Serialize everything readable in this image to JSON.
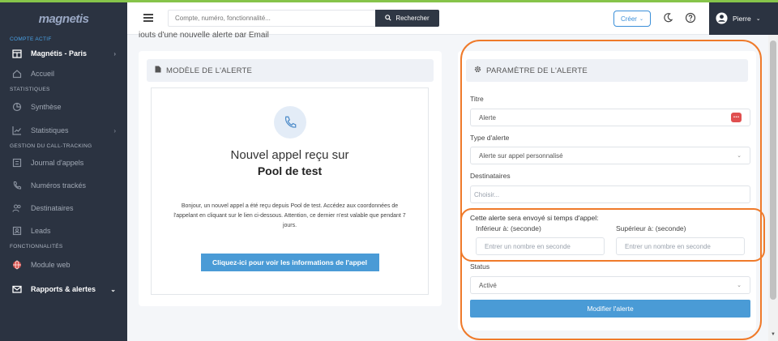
{
  "sidebar": {
    "logo": "magnetis",
    "sections": {
      "active_account": "COMPTE ACTIF",
      "stats": "STATISTIQUES",
      "calltracking": "GESTION DU CALL-TRACKING",
      "features": "FONCTIONNALITÉS"
    },
    "account": "Magnétis - Paris",
    "items": {
      "home": "Accueil",
      "summary": "Synthèse",
      "statistics": "Statistiques",
      "call_log": "Journal d'appels",
      "tracked_numbers": "Numéros trackés",
      "recipients": "Destinataires",
      "leads": "Leads",
      "web_module": "Module web",
      "reports": "Rapports & alertes"
    }
  },
  "topbar": {
    "search_placeholder": "Compte, numéro, fonctionnalité...",
    "search_button": "Rechercher",
    "create_button": "Créer",
    "user_name": "Pierre"
  },
  "page": {
    "cut_text": "jouts d'une nouvelle alerte par Email"
  },
  "model_card": {
    "header": "MODÈLE DE L'ALERTE",
    "title_line1": "Nouvel appel reçu sur",
    "title_line2": "Pool de test",
    "body": "Bonjour, un nouvel appel a été reçu depuis Pool de test. Accédez aux coordonnées de l'appelant en cliquant sur le lien ci-dessous. Attention, ce dernier n'est valable que pendant 7 jours.",
    "button": "Cliquez-ici pour voir les informations de l'appel"
  },
  "params_card": {
    "header": "PARAMÈTRE DE L'ALERTE",
    "title_label": "Titre",
    "title_value": "Alerte",
    "type_label": "Type d'alerte",
    "type_value": "Alerte sur appel personnalisé",
    "recipients_label": "Destinataires",
    "recipients_placeholder": "Choisir...",
    "time_condition": "Cette alerte sera envoyé si temps d'appel:",
    "lower_label": "Inférieur à:",
    "upper_label": "Supérieur à:",
    "unit": "(seconde)",
    "lower_placeholder": "Entrer un nombre en seconde",
    "upper_placeholder": "Entrer un nombre en seconde",
    "status_label": "Status",
    "status_value": "Activé",
    "submit_button": "Modifier l'alerte"
  },
  "colors": {
    "sidebar_bg": "#2b3341",
    "accent": "#4a9bd6",
    "highlight_ring": "#ef7a2a"
  }
}
